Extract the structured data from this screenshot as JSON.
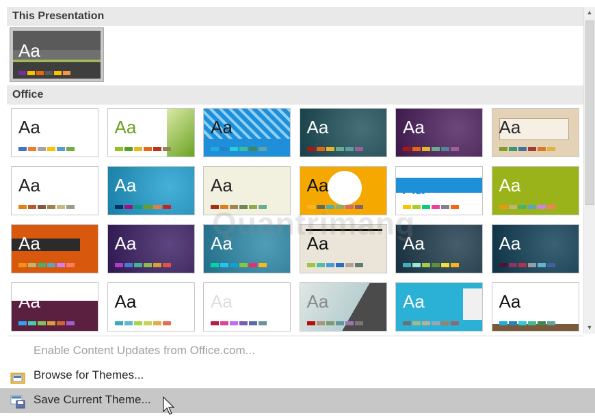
{
  "sections": {
    "this_presentation": "This Presentation",
    "office": "Office"
  },
  "thumb_text": "Aa",
  "current_theme": {
    "name": "current-presentation-theme",
    "swatches": [
      "#7030a0",
      "#ffc000",
      "#e36c09",
      "#5a5a5a",
      "#ffc000",
      "#f79646"
    ]
  },
  "office_themes": [
    {
      "name": "office-theme",
      "bg": "#ffffff",
      "fg": "#222222",
      "swatches": [
        "#4472c4",
        "#ed7d31",
        "#a5a5a5",
        "#ffc000",
        "#5b9bd5",
        "#70ad47"
      ]
    },
    {
      "name": "facet",
      "bg": "#ffffff",
      "fg": "#6aa121",
      "swatches": [
        "#90c226",
        "#54a021",
        "#e6b91e",
        "#e76618",
        "#c42f1a",
        "#918655"
      ]
    },
    {
      "name": "integral",
      "bg": "#1e8fd8",
      "fg": "#1a1a1a",
      "swatches": [
        "#1cade4",
        "#2683c6",
        "#27ced7",
        "#42ba97",
        "#3e8853",
        "#62a39f"
      ]
    },
    {
      "name": "ion-boardroom",
      "bg": "#1d4f5a",
      "fg": "#ffffff",
      "swatches": [
        "#b01513",
        "#ea6312",
        "#e6b729",
        "#6aac90",
        "#5f9c9d",
        "#9e5e9b"
      ]
    },
    {
      "name": "ion",
      "bg": "#4b1f5d",
      "fg": "#ffffff",
      "swatches": [
        "#b01513",
        "#ea6312",
        "#e6b729",
        "#6aac90",
        "#54849a",
        "#9e5e9b"
      ]
    },
    {
      "name": "organic",
      "bg": "#e4d2b6",
      "fg": "#2a2a2a",
      "swatches": [
        "#83992a",
        "#3c9770",
        "#44709d",
        "#a23c33",
        "#d97828",
        "#deb340"
      ]
    },
    {
      "name": "retrospect",
      "bg": "#ffffff",
      "fg": "#222222",
      "swatches": [
        "#e48312",
        "#bd582c",
        "#865640",
        "#9b8357",
        "#c2bc80",
        "#94a088"
      ]
    },
    {
      "name": "slice",
      "bg": "#1e9fd0",
      "fg": "#ffffff",
      "swatches": [
        "#052f61",
        "#a50e82",
        "#14967c",
        "#6a9e1f",
        "#e87d37",
        "#c62324"
      ]
    },
    {
      "name": "wisp",
      "bg": "#f2f0df",
      "fg": "#222222",
      "swatches": [
        "#a53010",
        "#de7e18",
        "#9f8351",
        "#728653",
        "#92aa4c",
        "#6aac91"
      ]
    },
    {
      "name": "badge",
      "bg": "#f5a800",
      "fg": "#111111",
      "swatches": [
        "#f8b323",
        "#656a59",
        "#46b2b5",
        "#8caa7e",
        "#d36f68",
        "#826276"
      ]
    },
    {
      "name": "banded",
      "bg": "#ffffff",
      "fg": "#1e90d8",
      "swatches": [
        "#ffc000",
        "#a5d028",
        "#08cc78",
        "#f24099",
        "#828288",
        "#f56617"
      ]
    },
    {
      "name": "basis",
      "bg": "#9bb31b",
      "fg": "#ffffff",
      "swatches": [
        "#f09415",
        "#c1b56b",
        "#4baf73",
        "#5aa6c0",
        "#d17df9",
        "#fa7e5c"
      ]
    },
    {
      "name": "berlin",
      "bg": "#d8590e",
      "fg": "#ffffff",
      "swatches": [
        "#f09415",
        "#c1b56b",
        "#4baf73",
        "#5aa6c0",
        "#d17df9",
        "#fa7e5c"
      ]
    },
    {
      "name": "celestial",
      "bg": "#3a1d63",
      "fg": "#ffffff",
      "swatches": [
        "#ac3ec1",
        "#477bd1",
        "#46b298",
        "#90ba4c",
        "#dd9d31",
        "#e25247"
      ]
    },
    {
      "name": "circuit",
      "bg": "#2a88a8",
      "fg": "#ffffff",
      "swatches": [
        "#03d4a8",
        "#21c4f4",
        "#0ca2d6",
        "#8bc53f",
        "#ed2d6b",
        "#f6b81c"
      ]
    },
    {
      "name": "damask",
      "bg": "#eae5d8",
      "fg": "#111111",
      "swatches": [
        "#9ec544",
        "#50bea3",
        "#4a9bdc",
        "#2a6ebb",
        "#b5a39a",
        "#5f7c71"
      ]
    },
    {
      "name": "depth",
      "bg": "#1d3a4c",
      "fg": "#ffffff",
      "swatches": [
        "#41aebd",
        "#97e9d5",
        "#a2cf49",
        "#608f3d",
        "#f4de3a",
        "#fcb11c"
      ]
    },
    {
      "name": "dividend",
      "bg": "#0f3e55",
      "fg": "#ffffff",
      "swatches": [
        "#4d1434",
        "#903163",
        "#b2324b",
        "#969fa7",
        "#66b1ce",
        "#40619d"
      ]
    },
    {
      "name": "droplet",
      "bg": "#5b2040",
      "fg": "#ffffff",
      "swatches": [
        "#2fa3ee",
        "#4bcaad",
        "#86c157",
        "#d99c3f",
        "#ce6633",
        "#a35dd1"
      ]
    },
    {
      "name": "frame",
      "bg": "#ffffff",
      "fg": "#111111",
      "swatches": [
        "#40a7c2",
        "#5fb8cb",
        "#a7d34f",
        "#c7d356",
        "#e8a94a",
        "#e06f55"
      ]
    },
    {
      "name": "gallery",
      "bg": "#ffffff",
      "fg": "#dddddd",
      "swatches": [
        "#b71e42",
        "#de478e",
        "#bc72f0",
        "#795faf",
        "#586ea6",
        "#6892a0"
      ]
    },
    {
      "name": "main-event",
      "bg": "#eef2f0",
      "fg": "#888888",
      "swatches": [
        "#b80e0f",
        "#a6987d",
        "#7f9a71",
        "#64969f",
        "#9b75b2",
        "#80737a"
      ]
    },
    {
      "name": "mesh",
      "bg": "#2bb0d6",
      "fg": "#ffffff",
      "swatches": [
        "#6f6f74",
        "#a7b789",
        "#beae98",
        "#92a9b9",
        "#9c8265",
        "#8d6974"
      ]
    },
    {
      "name": "savon",
      "bg": "#ffffff",
      "fg": "#111111",
      "swatches": [
        "#1cade4",
        "#2683c6",
        "#27ced7",
        "#42ba97",
        "#3e8853",
        "#62a39f"
      ]
    }
  ],
  "menu": {
    "enable_updates": "Enable Content Updates from Office.com...",
    "browse_themes": "Browse for Themes...",
    "save_theme": "Save Current Theme..."
  },
  "watermark": "Quantrimang"
}
